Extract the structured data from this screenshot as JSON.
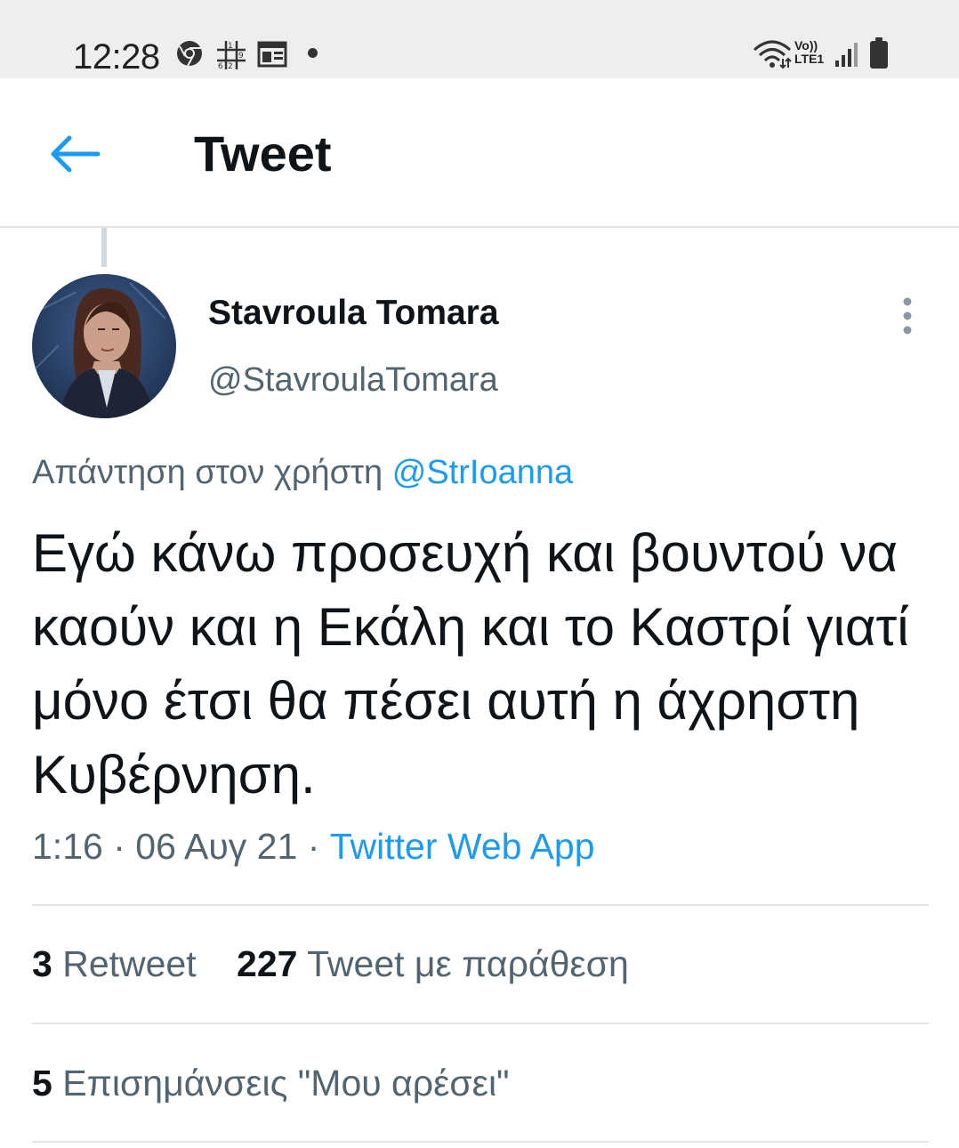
{
  "status_bar": {
    "time": "12:28",
    "icons": [
      "chrome-icon",
      "sudoku-icon",
      "news-icon",
      "notification-dot-icon"
    ],
    "right_icons": [
      "wifi-icon",
      "volte-icon",
      "signal-icon",
      "battery-icon"
    ],
    "volte_top": "Vo))",
    "volte_bottom": "LTE1"
  },
  "header": {
    "back_icon": "arrow-left-icon",
    "title": "Tweet"
  },
  "tweet": {
    "author_name": "Stavroula Tomara",
    "author_handle": "@StavroulaTomara",
    "reply_prefix": "Απάντηση στον χρήστη",
    "reply_to": "@StrIoanna",
    "text": "Εγώ κάνω προσευχή και βουντού να καούν και η Εκάλη και το Καστρί γιατί μόνο έτσι θα πέσει αυτή η άχρηστη Κυβέρνηση.",
    "time": "1:16",
    "separator": "·",
    "date": "06 Αυγ 21",
    "source": "Twitter Web App"
  },
  "stats": {
    "retweets_count": "3",
    "retweets_label": "Retweet",
    "quotes_count": "227",
    "quotes_label": "Tweet με παράθεση",
    "likes_count": "5",
    "likes_label": "Επισημάνσεις \"Μου αρέσει\""
  },
  "colors": {
    "accent": "#1d9bf0",
    "secondary_text": "#536471",
    "primary_text": "#0f1419",
    "divider": "#e3e6e8",
    "status_bar_bg": "#eeeeee"
  }
}
